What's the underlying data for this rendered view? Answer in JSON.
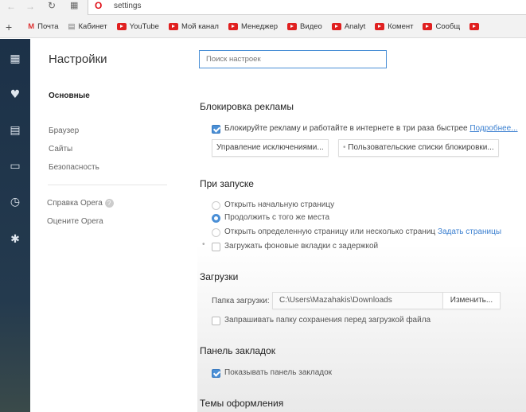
{
  "browser": {
    "address": "settings",
    "nav_icons": [
      "back-icon",
      "forward-icon",
      "reload-icon",
      "speed-dial-icon"
    ]
  },
  "bookmarks": [
    {
      "label": "Почта",
      "icon": "gmail-icon"
    },
    {
      "label": "Кабинет",
      "icon": "page-icon"
    },
    {
      "label": "YouTube",
      "icon": "youtube-icon"
    },
    {
      "label": "Мой канал",
      "icon": "youtube-icon"
    },
    {
      "label": "Менеджер",
      "icon": "youtube-icon"
    },
    {
      "label": "Видео",
      "icon": "youtube-icon"
    },
    {
      "label": "Analyt",
      "icon": "youtube-icon"
    },
    {
      "label": "Комент",
      "icon": "youtube-icon"
    },
    {
      "label": "Сообщ",
      "icon": "youtube-icon"
    }
  ],
  "sidebar_icons": [
    "speed-dial-icon",
    "heart-icon",
    "news-icon",
    "devices-icon",
    "history-icon",
    "extensions-icon"
  ],
  "left": {
    "title": "Настройки",
    "active": "Основные",
    "items": [
      "Браузер",
      "Сайты",
      "Безопасность"
    ],
    "help": "Справка Opera",
    "rate": "Оцените Opera"
  },
  "search": {
    "placeholder": "Поиск настроек"
  },
  "adblock": {
    "title": "Блокировка рекламы",
    "checkbox": "Блокируйте рекламу и работайте в интернете в три раза быстрее",
    "checked": true,
    "more": "Подробнее...",
    "btn_exceptions": "Управление исключениями...",
    "btn_lists": "Пользовательские списки блокировки..."
  },
  "startup": {
    "title": "При запуске",
    "options": [
      "Открыть начальную страницу",
      "Продолжить с того же места",
      "Открыть определенную страницу или несколько страниц"
    ],
    "selected": 1,
    "set_pages": "Задать страницы",
    "delay_tabs": "Загружать фоновые вкладки с задержкой",
    "delay_checked": false
  },
  "downloads": {
    "title": "Загрузки",
    "folder_label": "Папка загрузки:",
    "folder_value": "C:\\Users\\Mazahakis\\Downloads",
    "change": "Изменить...",
    "ask": "Запрашивать папку сохранения перед загрузкой файла",
    "ask_checked": false
  },
  "bookmarks_bar": {
    "title": "Панель закладок",
    "show": "Показывать панель закладок",
    "show_checked": true
  },
  "themes": {
    "title": "Темы оформления"
  },
  "colors": {
    "accent": "#4a8fd6",
    "sidebar": "#1c3148",
    "link": "#3a7fd0"
  }
}
